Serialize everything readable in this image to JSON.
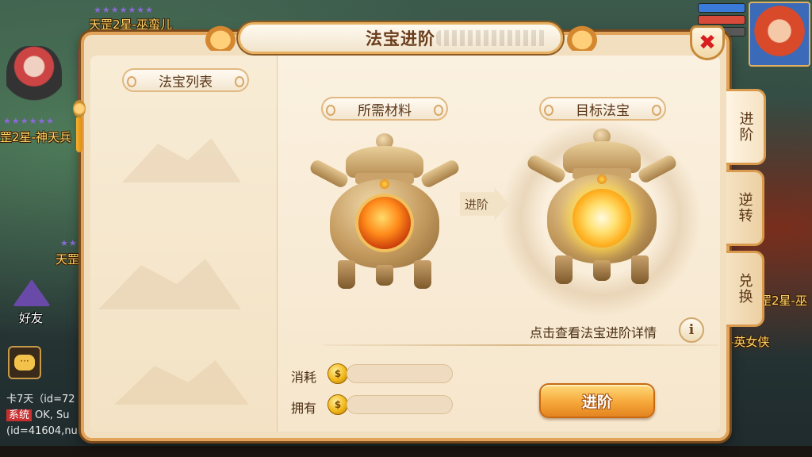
{
  "dialog": {
    "title": "法宝进阶",
    "close_label": "✖"
  },
  "left_panel": {
    "header": "法宝列表"
  },
  "materials": {
    "header": "所需材料"
  },
  "target": {
    "header": "目标法宝"
  },
  "arrow_label": "进阶",
  "detail_link": "点击查看法宝进阶详情",
  "info_icon": "i",
  "resources": {
    "consume_label": "消耗",
    "own_label": "拥有",
    "consume_value": "",
    "own_value": ""
  },
  "advance_button": "进阶",
  "side_tabs": [
    {
      "label": "进阶",
      "active": true
    },
    {
      "label": "逆转",
      "active": false
    },
    {
      "label": "兑换",
      "active": false
    }
  ],
  "background": {
    "labels": [
      "天罡2星-巫蛮儿",
      "罡2星-神天兵",
      "天罡",
      "好友",
      "罡2星-巫",
      "-英女侠"
    ],
    "chat_lines": [
      "卡7天（id=72",
      "系统",
      "OK, Su",
      "(id=41604,nu"
    ]
  },
  "colors": {
    "dialog_border": "#e2a45a",
    "title_text": "#6a3d1c",
    "button_orange": "#f6a83a",
    "close_red": "#d81e1e"
  }
}
